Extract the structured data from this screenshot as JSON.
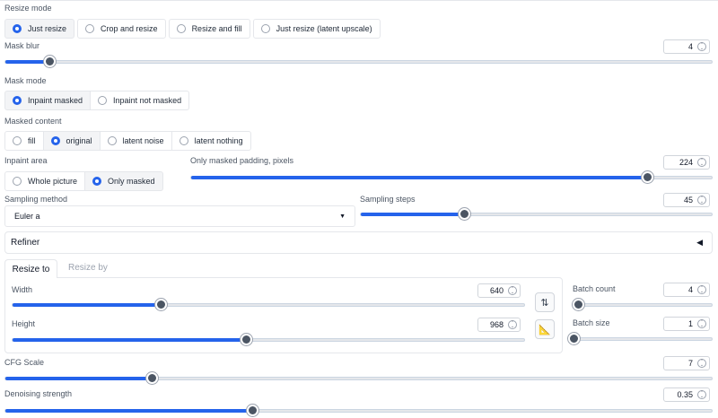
{
  "resize_mode": {
    "label": "Resize mode",
    "options": [
      "Just resize",
      "Crop and resize",
      "Resize and fill",
      "Just resize (latent upscale)"
    ],
    "selected": 0
  },
  "mask_blur": {
    "label": "Mask blur",
    "value": "4",
    "min": 0,
    "max": 64,
    "num": 4
  },
  "mask_mode": {
    "label": "Mask mode",
    "options": [
      "Inpaint masked",
      "Inpaint not masked"
    ],
    "selected": 0
  },
  "masked_content": {
    "label": "Masked content",
    "options": [
      "fill",
      "original",
      "latent noise",
      "latent nothing"
    ],
    "selected": 1
  },
  "inpaint_area": {
    "label": "Inpaint area",
    "options": [
      "Whole picture",
      "Only masked"
    ],
    "selected": 1
  },
  "only_masked_padding": {
    "label": "Only masked padding, pixels",
    "value": "224",
    "min": 0,
    "max": 256,
    "num": 224
  },
  "sampling_method": {
    "label": "Sampling method",
    "value": "Euler a"
  },
  "sampling_steps": {
    "label": "Sampling steps",
    "value": "45",
    "min": 1,
    "max": 150,
    "num": 45
  },
  "refiner": {
    "label": "Refiner"
  },
  "resize_tabs": {
    "tabs": [
      "Resize to",
      "Resize by"
    ],
    "active": 0
  },
  "width": {
    "label": "Width",
    "value": "640",
    "min": 64,
    "max": 2048,
    "num": 640
  },
  "height": {
    "label": "Height",
    "value": "968",
    "min": 64,
    "max": 2048,
    "num": 968
  },
  "batch_count": {
    "label": "Batch count",
    "value": "4",
    "min": 1,
    "max": 100,
    "num": 4
  },
  "batch_size": {
    "label": "Batch size",
    "value": "1",
    "min": 1,
    "max": 8,
    "num": 1
  },
  "cfg_scale": {
    "label": "CFG Scale",
    "value": "7",
    "min": 1,
    "max": 30,
    "num": 7
  },
  "denoising_strength": {
    "label": "Denoising strength",
    "value": "0.35",
    "min": 0,
    "max": 1,
    "num": 0.35
  },
  "icons": {
    "swap": "⇅",
    "ruler": "📐",
    "dropdown": "▼",
    "refiner_toggle": "◀"
  },
  "colors": {
    "accent": "#2563eb",
    "thumb": "#4b5563"
  }
}
